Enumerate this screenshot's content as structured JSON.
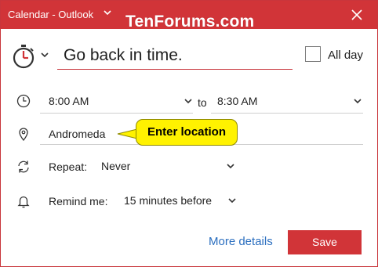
{
  "window": {
    "title": "Calendar - Outlook",
    "watermark": "TenForums.com",
    "accent_color": "#d13438"
  },
  "event": {
    "subject": "Go back in time.",
    "all_day_label": "All day",
    "all_day_checked": false
  },
  "time": {
    "start": "8:00 AM",
    "separator": "to",
    "end": "8:30 AM"
  },
  "location": {
    "value": "Andromeda",
    "callout": "Enter location"
  },
  "repeat": {
    "label": "Repeat:",
    "value": "Never"
  },
  "reminder": {
    "label": "Remind me:",
    "value": "15 minutes before"
  },
  "footer": {
    "more_details": "More details",
    "save": "Save"
  },
  "icons": [
    "stopwatch-icon",
    "clock-icon",
    "location-pin-icon",
    "repeat-icon",
    "bell-icon",
    "chevron-down-icon",
    "close-icon"
  ]
}
